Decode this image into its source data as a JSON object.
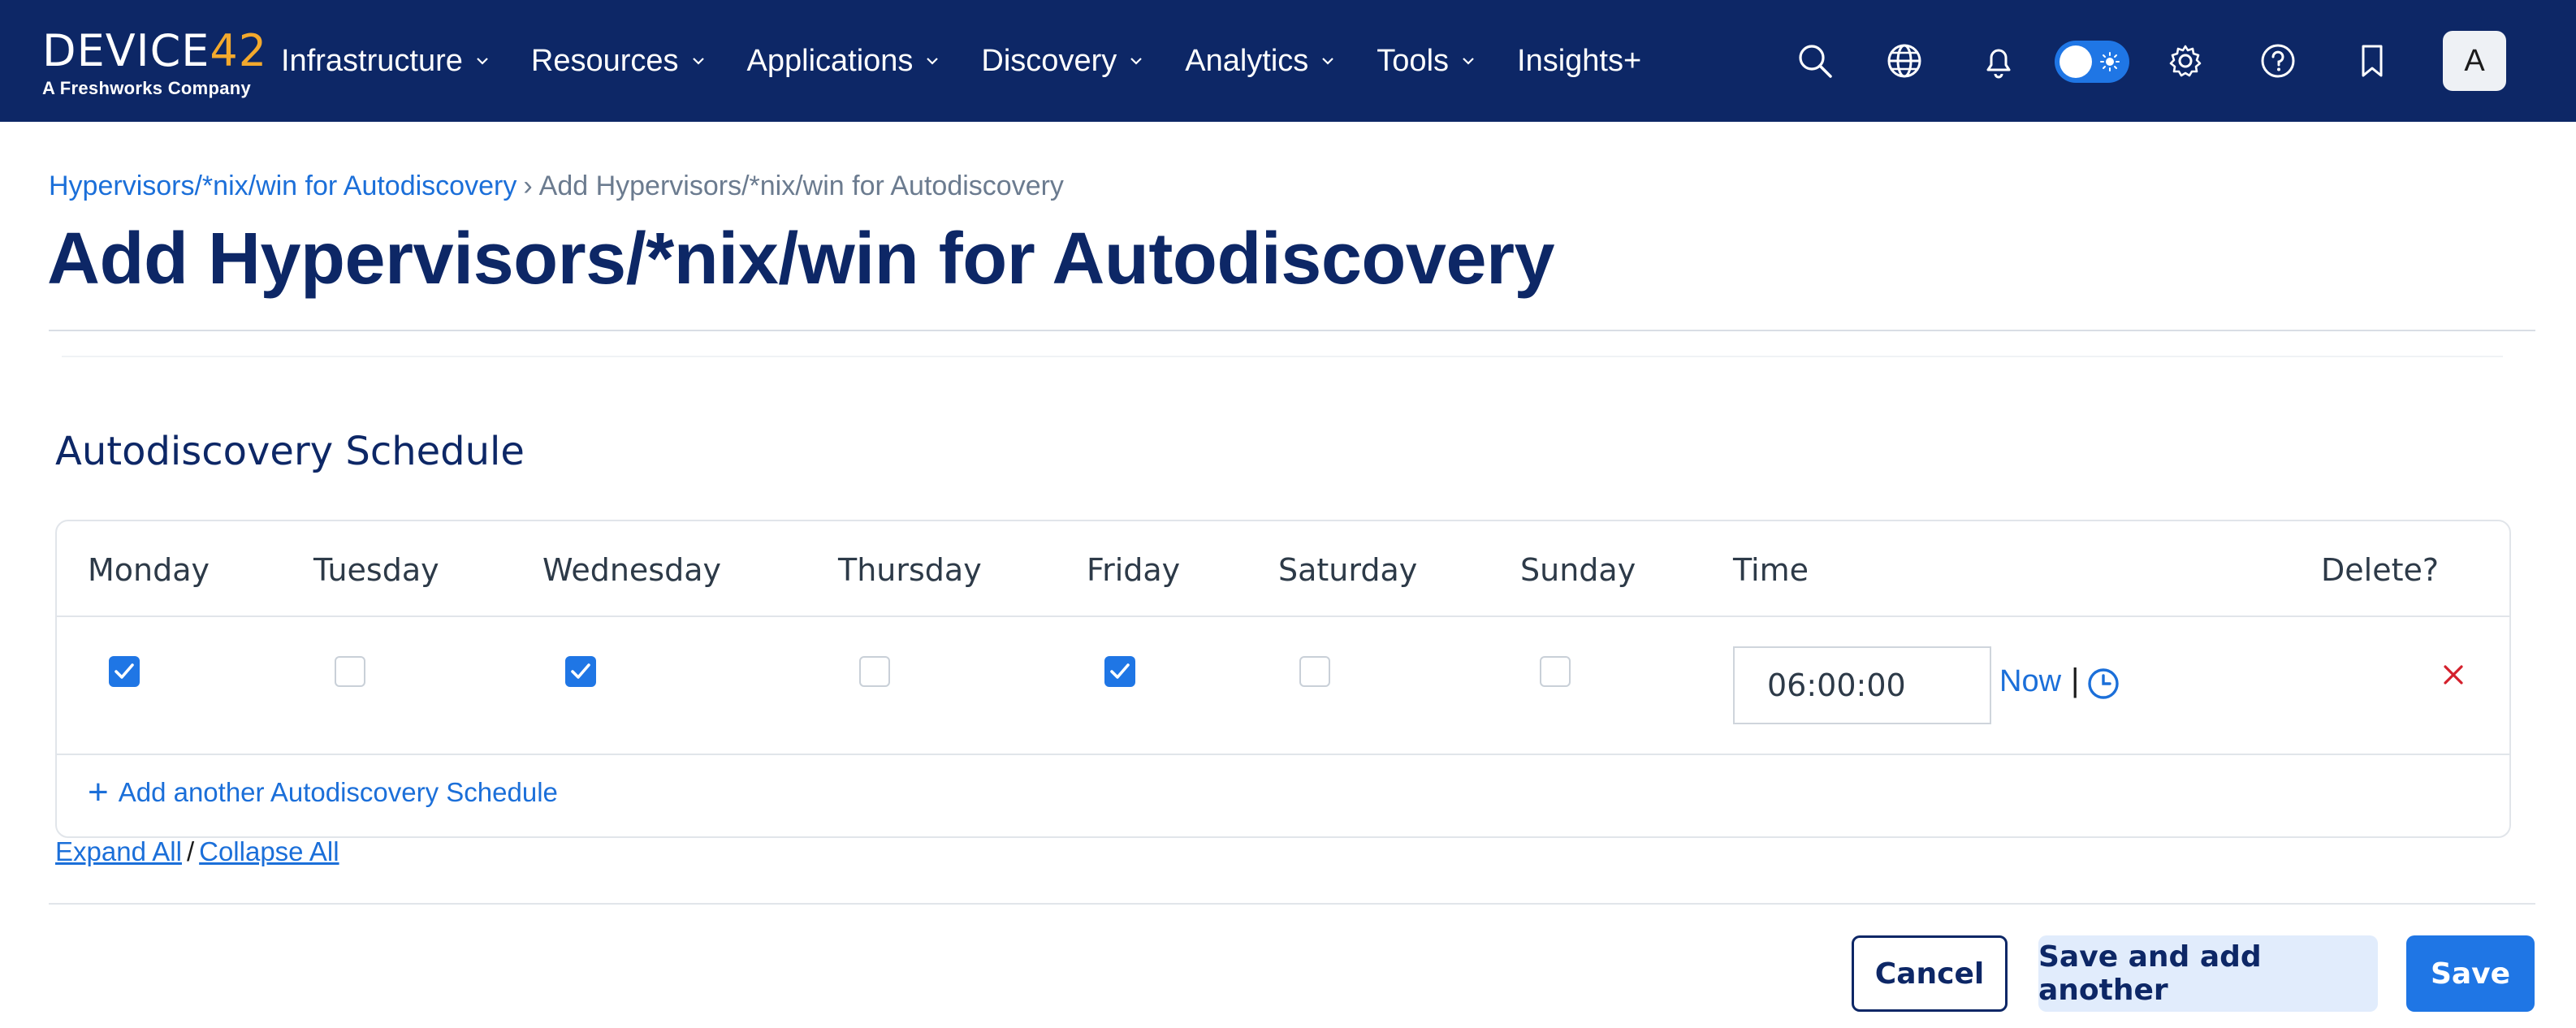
{
  "brand": {
    "logo_text_a": "DEVICE",
    "logo_text_b": "42",
    "tagline": "A Freshworks Company",
    "accent_color": "#f3a92d",
    "nav_bg": "#0d2766"
  },
  "nav": {
    "items": [
      {
        "label": "Infrastructure",
        "has_dropdown": true
      },
      {
        "label": "Resources",
        "has_dropdown": true
      },
      {
        "label": "Applications",
        "has_dropdown": true
      },
      {
        "label": "Discovery",
        "has_dropdown": true
      },
      {
        "label": "Analytics",
        "has_dropdown": true
      },
      {
        "label": "Tools",
        "has_dropdown": true
      },
      {
        "label": "Insights+",
        "has_dropdown": false
      }
    ],
    "icons": [
      "search-icon",
      "globe-icon",
      "bell-icon",
      "theme-toggle",
      "gear-icon",
      "help-icon",
      "bookmark-icon"
    ],
    "avatar_initial": "A"
  },
  "breadcrumb": {
    "parent": "Hypervisors/*nix/win for Autodiscovery",
    "separator": "›",
    "current": "Add Hypervisors/*nix/win for Autodiscovery"
  },
  "page_title": "Add Hypervisors/*nix/win for Autodiscovery",
  "section": {
    "title": "Autodiscovery Schedule"
  },
  "schedule": {
    "columns": [
      "Monday",
      "Tuesday",
      "Wednesday",
      "Thursday",
      "Friday",
      "Saturday",
      "Sunday",
      "Time",
      "Delete?"
    ],
    "rows": [
      {
        "days": [
          true,
          false,
          true,
          false,
          true,
          false,
          false
        ],
        "time": "06:00:00",
        "now_label": "Now",
        "pipe": "|"
      }
    ],
    "add_label": "Add another Autodiscovery Schedule",
    "add_plus": "+"
  },
  "expand": {
    "expand_label": "Expand All",
    "slash": "/",
    "collapse_label": "Collapse All"
  },
  "buttons": {
    "cancel": "Cancel",
    "save_another": "Save and add another",
    "save": "Save"
  }
}
